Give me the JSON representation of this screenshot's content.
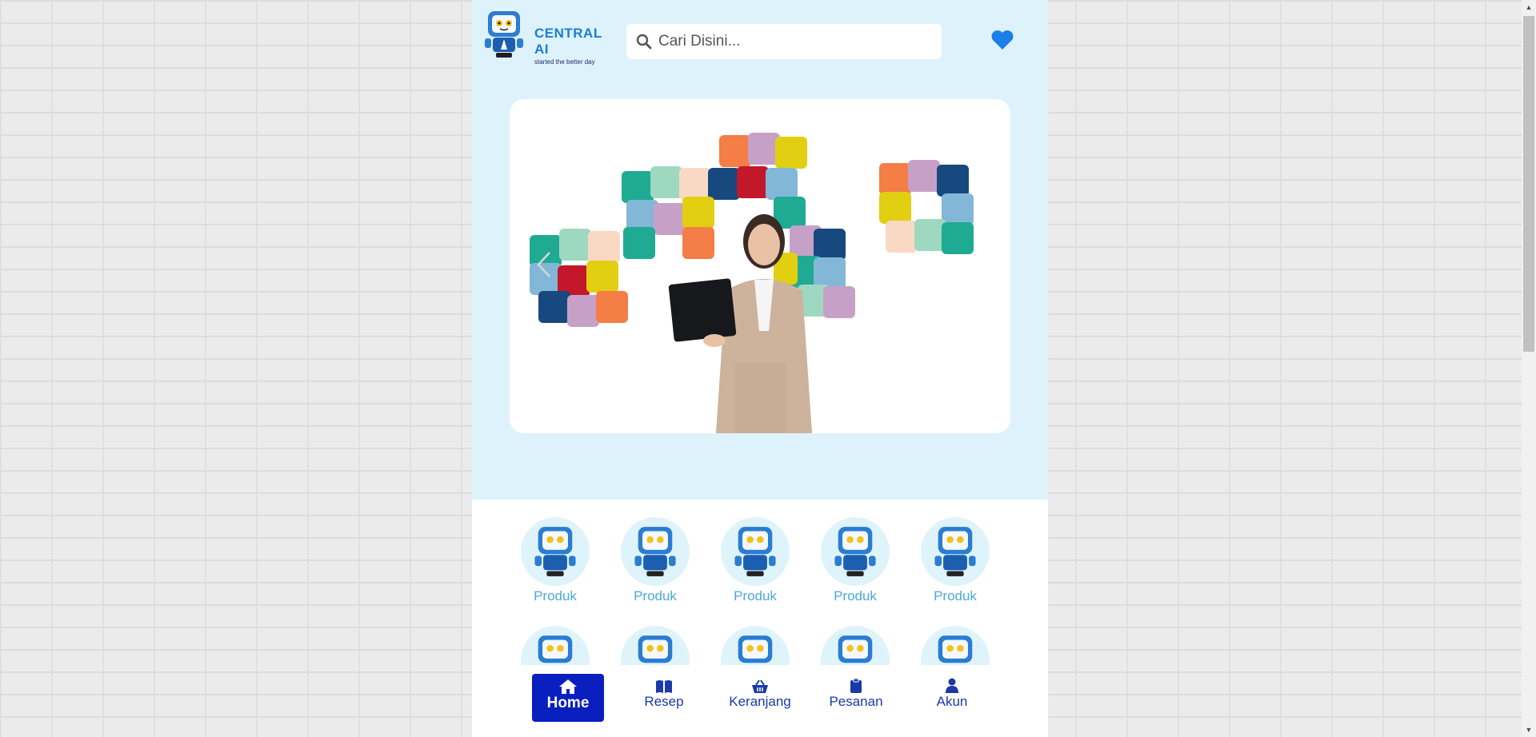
{
  "header": {
    "logo_title": "CENTRAL AI",
    "logo_subtitle": "started the better day",
    "search_placeholder": "Cari Disini..."
  },
  "menu_items": [
    {
      "label": "Produk"
    },
    {
      "label": "Produk"
    },
    {
      "label": "Produk"
    },
    {
      "label": "Produk"
    },
    {
      "label": "Produk"
    }
  ],
  "bottom_nav": [
    {
      "label": "Home",
      "icon": "home-icon",
      "active": true
    },
    {
      "label": "Resep",
      "icon": "book-icon"
    },
    {
      "label": "Keranjang",
      "icon": "basket-icon"
    },
    {
      "label": "Pesanan",
      "icon": "clipboard-icon"
    },
    {
      "label": "Akun",
      "icon": "user-icon"
    }
  ],
  "colors": {
    "brand": "#1a7fd6",
    "nav_active": "#0a1fbf",
    "nav_text": "#1a3aa8",
    "header_bg": "#ddf2fb",
    "menu_label": "#4ea8d8"
  }
}
